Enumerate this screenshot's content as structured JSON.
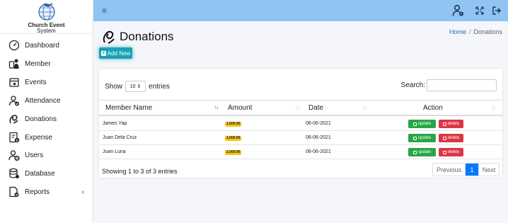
{
  "brand": {
    "title": "Church Event",
    "subtitle": "System"
  },
  "sidebar": {
    "items": [
      {
        "label": "Dashboard",
        "icon": "speedometer-icon"
      },
      {
        "label": "Member",
        "icon": "member-icon"
      },
      {
        "label": "Events",
        "icon": "calendar-icon"
      },
      {
        "label": "Attendance",
        "icon": "user-check-icon"
      },
      {
        "label": "Donations",
        "icon": "donation-icon"
      },
      {
        "label": "Expense",
        "icon": "invoice-icon"
      },
      {
        "label": "Users",
        "icon": "user-cog-icon"
      },
      {
        "label": "Database",
        "icon": "database-icon"
      },
      {
        "label": "Reports",
        "icon": "report-icon",
        "caret": "‹"
      }
    ]
  },
  "topbar": {
    "menu_icon": "≡"
  },
  "page": {
    "title": "Donations"
  },
  "breadcrumb": {
    "home": "Home",
    "separator": "/",
    "current": "Donations"
  },
  "add_button": {
    "label": "Add New"
  },
  "table_controls": {
    "show_label": "Show",
    "entries_value": "10",
    "entries_caret": "⇕",
    "entries_label": "entries",
    "search_label": "Search:",
    "search_value": ""
  },
  "table": {
    "columns": [
      "Member Name",
      "Amount",
      "Date",
      "Action"
    ],
    "sort_glyph": "↑↓",
    "rows": [
      {
        "name": "James Yap",
        "amount": "1,500.00",
        "date": "06-06-2021"
      },
      {
        "name": "Juan Dela Cruz",
        "amount": "1,000.00",
        "date": "06-06-2021"
      },
      {
        "name": "Juan Luna",
        "amount": "2,000.00",
        "date": "06-06-2021"
      }
    ],
    "update_label": "update",
    "delete_label": "delete"
  },
  "footer": {
    "info": "Showing 1 to 3 of 3 entries",
    "prev": "Previous",
    "page": "1",
    "next": "Next"
  },
  "colors": {
    "topbar": "#91c3f3",
    "accent": "#17a2b8",
    "success": "#28a745",
    "danger": "#dc3545",
    "badge": "#f5c518",
    "primary": "#007bff"
  }
}
